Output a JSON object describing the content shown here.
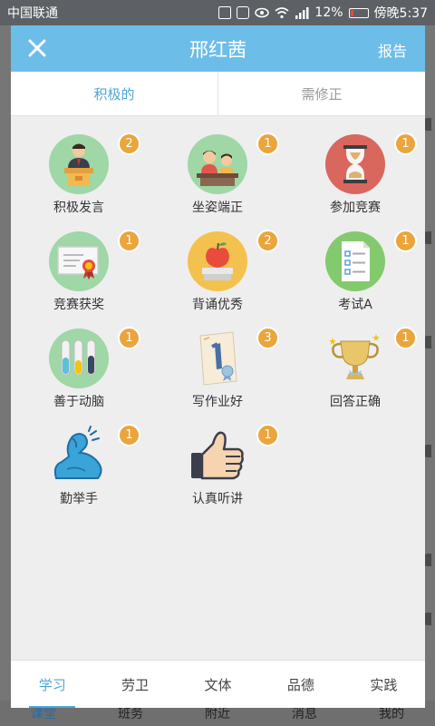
{
  "status_bar": {
    "carrier": "中国联通",
    "battery": "12%",
    "time": "傍晚5:37"
  },
  "modal": {
    "title": "邢红茜",
    "close_icon": "close-icon",
    "report_label": "报告",
    "tabs": [
      {
        "label": "积极的",
        "active": true
      },
      {
        "label": "需修正",
        "active": false
      }
    ],
    "badges": [
      {
        "label": "积极发言",
        "count": "2",
        "icon": "podium-speaker-icon"
      },
      {
        "label": "坐姿端正",
        "count": "1",
        "icon": "students-desk-icon"
      },
      {
        "label": "参加竞赛",
        "count": "1",
        "icon": "hourglass-icon"
      },
      {
        "label": "竞赛获奖",
        "count": "1",
        "icon": "certificate-icon"
      },
      {
        "label": "背诵优秀",
        "count": "2",
        "icon": "apple-books-icon"
      },
      {
        "label": "考试A",
        "count": "1",
        "icon": "checklist-icon"
      },
      {
        "label": "善于动脑",
        "count": "1",
        "icon": "test-tubes-icon"
      },
      {
        "label": "写作业好",
        "count": "3",
        "icon": "homework-paper-icon"
      },
      {
        "label": "回答正确",
        "count": "1",
        "icon": "trophy-icon"
      },
      {
        "label": "勤举手",
        "count": "1",
        "icon": "flexed-arm-icon"
      },
      {
        "label": "认真听讲",
        "count": "1",
        "icon": "thumbs-up-icon"
      }
    ],
    "bottom_tabs": [
      {
        "label": "学习",
        "active": true
      },
      {
        "label": "劳卫",
        "active": false
      },
      {
        "label": "文体",
        "active": false
      },
      {
        "label": "品德",
        "active": false
      },
      {
        "label": "实践",
        "active": false
      }
    ]
  },
  "background_nav": [
    "课堂",
    "班务",
    "附近",
    "消息",
    "我的"
  ],
  "colors": {
    "header": "#6dbde9",
    "accent": "#4ea6d6",
    "badge": "#eba53d",
    "modal_bg": "#eeeeee"
  }
}
